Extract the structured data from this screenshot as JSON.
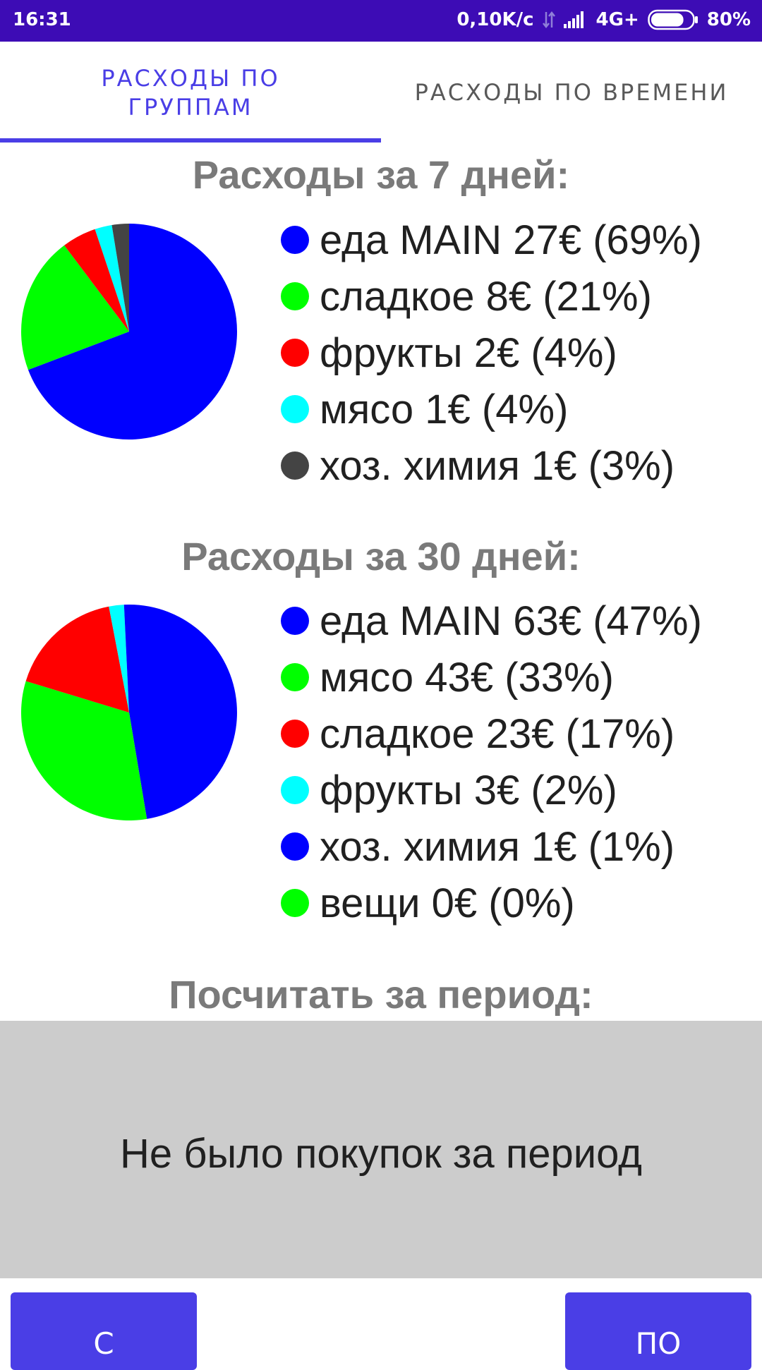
{
  "status_bar": {
    "time": "16:31",
    "network_speed": "0,10K/c",
    "network_type": "4G+",
    "battery": "80%",
    "battery_level": 0.8,
    "icons": [
      "data-transfer-icon",
      "signal-icon",
      "battery-icon"
    ]
  },
  "tabs": [
    {
      "label_line1": "РАСХОДЫ ПО",
      "label_line2": "ГРУППАМ",
      "active": true
    },
    {
      "label": "РАСХОДЫ ПО ВРЕМЕНИ",
      "active": false
    }
  ],
  "colors": {
    "accent": "#4a3ee6",
    "status_bar": "#3d0cb5",
    "panel": "#cccccc"
  },
  "sections": {
    "week": {
      "title": "Расходы за 7 дней:"
    },
    "month": {
      "title": "Расходы за 30 дней:"
    },
    "period": {
      "title": "Посчитать за период:",
      "message": "Не было покупок за период"
    }
  },
  "chart_data": [
    {
      "type": "pie",
      "title": "Расходы за 7 дней:",
      "slices": [
        {
          "label": "еда MAIN 27€ (69%)",
          "value": 27,
          "percent": 69,
          "color": "#0000ff"
        },
        {
          "label": "сладкое 8€ (21%)",
          "value": 8,
          "percent": 21,
          "color": "#00ff00"
        },
        {
          "label": "фрукты 2€ (4%)",
          "value": 2,
          "percent": 4,
          "color": "#ff0000"
        },
        {
          "label": "мясо 1€ (4%)",
          "value": 1,
          "percent": 4,
          "color": "#00ffff"
        },
        {
          "label": "хоз. химия 1€ (3%)",
          "value": 1,
          "percent": 3,
          "color": "#444444"
        }
      ]
    },
    {
      "type": "pie",
      "title": "Расходы за 30 дней:",
      "slices": [
        {
          "label": "еда MAIN 63€ (47%)",
          "value": 63,
          "percent": 47,
          "color": "#0000ff"
        },
        {
          "label": "мясо 43€ (33%)",
          "value": 43,
          "percent": 33,
          "color": "#00ff00"
        },
        {
          "label": "сладкое 23€ (17%)",
          "value": 23,
          "percent": 17,
          "color": "#ff0000"
        },
        {
          "label": "фрукты 3€ (2%)",
          "value": 3,
          "percent": 2,
          "color": "#00ffff"
        },
        {
          "label": "хоз. химия 1€ (1%)",
          "value": 1,
          "percent": 1,
          "color": "#0000ff"
        },
        {
          "label": "вещи 0€ (0%)",
          "value": 0,
          "percent": 0,
          "color": "#00ff00"
        }
      ]
    }
  ],
  "buttons": {
    "from_label": "С",
    "to_label": "ПО"
  }
}
